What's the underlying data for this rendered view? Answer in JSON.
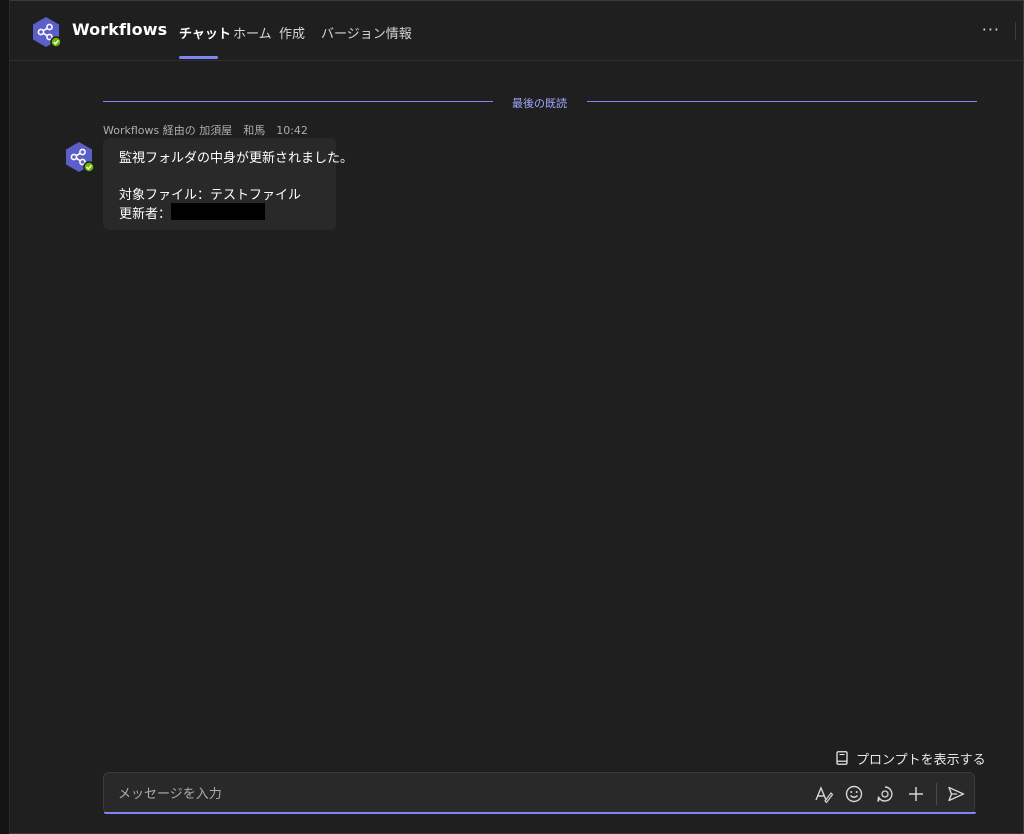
{
  "header": {
    "app_title": "Workflows",
    "tabs": [
      {
        "label": "チャット",
        "active": true
      },
      {
        "label": "ホーム",
        "active": false
      },
      {
        "label": "作成",
        "active": false
      },
      {
        "label": "バージョン情報",
        "active": false
      }
    ],
    "more_label": "···"
  },
  "divider": {
    "label": "最後の既読"
  },
  "message": {
    "meta": "Workflows 経由の 加須屋　和馬　10:42",
    "line1": "監視フォルダの中身が更新されました。",
    "line2": "対象ファイル：テストファイル",
    "line3": "更新者："
  },
  "prompt_toggle": {
    "label": "プロンプトを表示する"
  },
  "composer": {
    "placeholder": "メッセージを入力"
  },
  "colors": {
    "accent": "#7f85f5",
    "app_icon": "#5b5fc7",
    "status_green": "#6bb700",
    "background": "#1f1f1f"
  },
  "icons": {
    "app": "workflows-share-icon",
    "format": "format-icon",
    "emoji": "emoji-icon",
    "loop": "loop-icon",
    "attach": "plus-icon",
    "send": "send-icon",
    "prompt": "book-icon"
  }
}
